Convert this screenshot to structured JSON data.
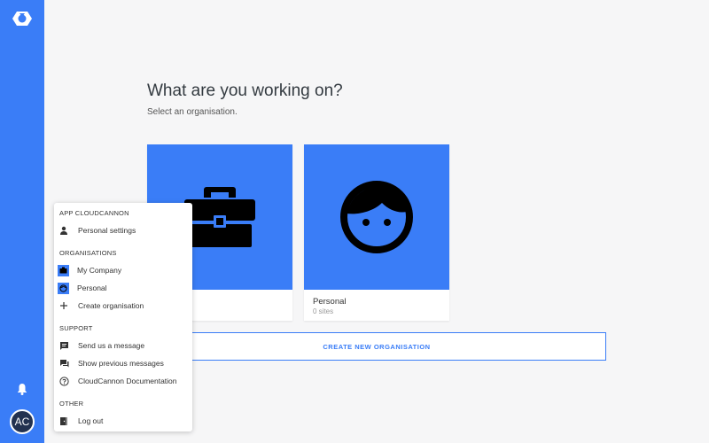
{
  "header": {
    "title": "What are you working on?",
    "subtitle": "Select an organisation."
  },
  "organisations": [
    {
      "name": "My Company",
      "visible_name": "ny",
      "meta": "",
      "icon": "briefcase-icon"
    },
    {
      "name": "Personal",
      "visible_name": "Personal",
      "meta": "0 sites",
      "icon": "face-icon"
    }
  ],
  "create_button": {
    "label": "CREATE NEW ORGANISATION"
  },
  "sidebar": {
    "avatar_initials": "AC",
    "notifications_icon": "bell-icon",
    "logo_icon": "cloudcannon-logo-icon"
  },
  "menu": {
    "app_section": "APP CLOUDCANNON",
    "personal_settings": "Personal settings",
    "organisations_section": "ORGANISATIONS",
    "org_items": [
      "My Company",
      "Personal"
    ],
    "create_org": "Create organisation",
    "support_section": "SUPPORT",
    "send_message": "Send us a message",
    "show_messages": "Show previous messages",
    "docs": "CloudCannon Documentation",
    "other_section": "OTHER",
    "log_out": "Log out"
  },
  "colors": {
    "accent": "#3a7df7",
    "avatar_bg": "#233250"
  }
}
